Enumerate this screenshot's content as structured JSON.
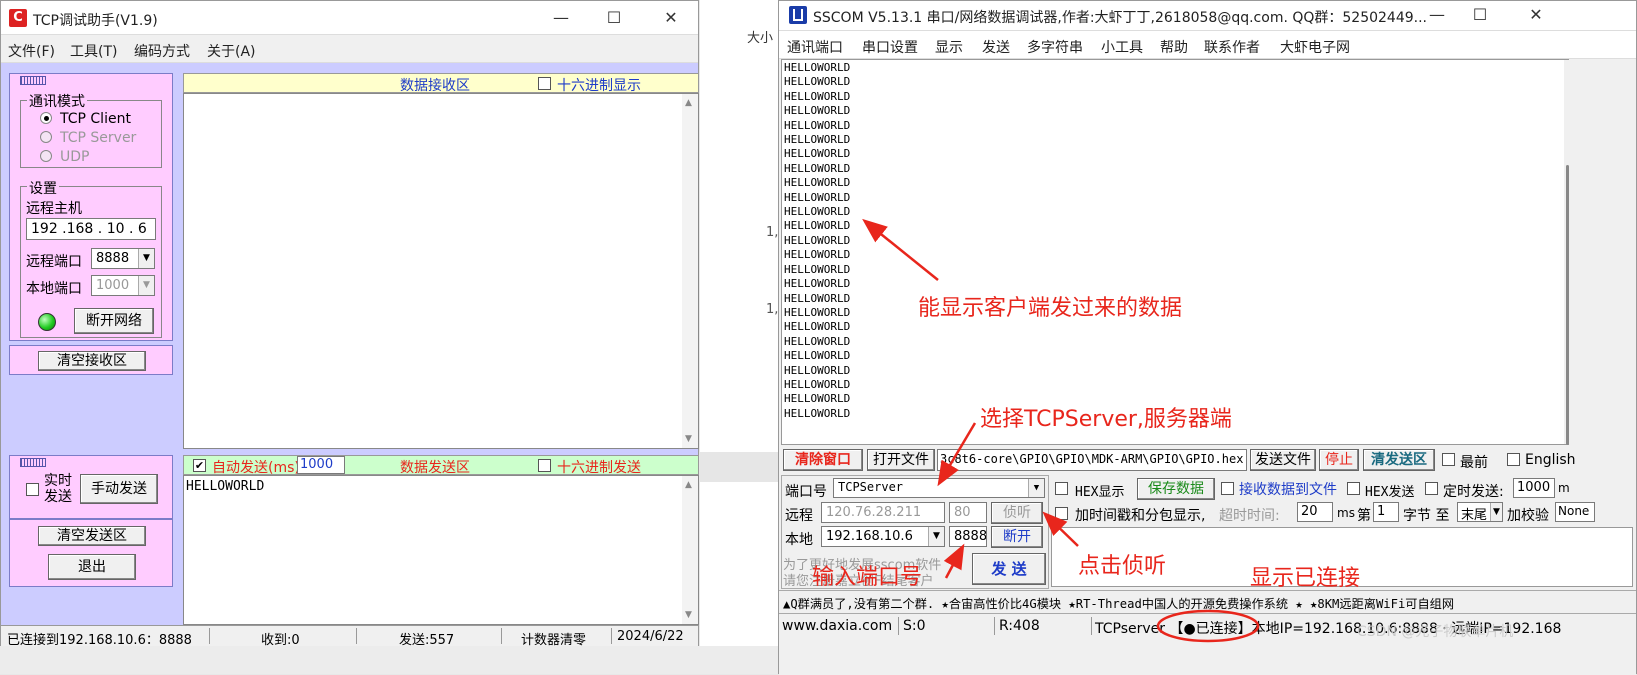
{
  "tcp": {
    "title": "TCP调试助手(V1.9)",
    "menus": [
      "文件(F)",
      "工具(T)",
      "编码方式",
      "关于(A)"
    ],
    "comm_mode_label": "通讯模式",
    "modes": [
      "TCP Client",
      "TCP Server",
      "UDP"
    ],
    "settings_label": "设置",
    "remote_host_label": "远程主机",
    "remote_host": "192 .168 . 10 . 6",
    "remote_port_label": "远程端口",
    "remote_port": "8888",
    "local_port_label": "本地端口",
    "local_port": "1000",
    "disconnect_btn": "断开网络",
    "clear_recv_btn": "清空接收区",
    "recv_title": "数据接收区",
    "hex_display": "十六进制显示",
    "realtime_send": "实时发送",
    "manual_send_btn": "手动发送",
    "clear_send_btn": "清空发送区",
    "exit_btn": "退出",
    "auto_send_label": "自动发送(ms)",
    "auto_send_interval": "1000",
    "send_title": "数据发送区",
    "hex_send": "十六进制发送",
    "send_text": "HELLOWORLD",
    "status": {
      "connected": "已连接到192.168.10.6：8888",
      "received": "收到:0",
      "sent": "发送:557",
      "reset": "计数器清零",
      "date": "2024/6/22"
    },
    "led_color": "#22cc22"
  },
  "bg": {
    "text1": "大小",
    "text2": "1,",
    "text3": "1,"
  },
  "sscom": {
    "title": "SSCOM V5.13.1 串口/网络数据调试器,作者:大虾丁丁,2618058@qq.com. QQ群：52502449...",
    "menus": [
      "通讯端口",
      "串口设置",
      "显示",
      "发送",
      "多字符串",
      "小工具",
      "帮助",
      "联系作者",
      "大虾电子网"
    ],
    "received_line": "HELLOWORLD",
    "received_count": 25,
    "btn_clear": "清除窗口",
    "btn_open": "打开文件",
    "file_path": "3c8t6-core\\GPIO\\GPIO\\MDK-ARM\\GPIO\\GPIO.hex",
    "btn_sendfile": "发送文件",
    "btn_stop": "停止",
    "btn_clear_send": "清发送区",
    "opt_top": "最前",
    "opt_english": "English",
    "port_label": "端口号",
    "port_value": "TCPServer",
    "hex_display": "HEX显示",
    "save_data": "保存数据",
    "recv_to_file": "接收数据到文件",
    "hex_send": "HEX发送",
    "timed_send": "定时发送:",
    "timed_value": "1000",
    "timed_unit": "m",
    "remote_label": "远程",
    "remote_ip": "120.76.28.211",
    "remote_port": "80",
    "listen_btn": "侦听",
    "timestamp_label": "加时间戳和分包显示,",
    "timeout_label": "超时时间:",
    "timeout_value": "20",
    "timeout_unit": "ms",
    "nth_label": "第",
    "nth_value": "1",
    "byte_label": "字节 至",
    "end_value": "末尾",
    "checksum_label": "加校验",
    "checksum_value": "None",
    "local_label": "本地",
    "local_ip": "192.168.10.6",
    "local_port": "8888",
    "disconnect_btn": "断开",
    "promo1": "为了更好地发展sscom软件",
    "promo2": "请您注册嘉立创F结尾客户",
    "send_btn": "发 送",
    "ticker": "▲Q群满员了,没有第二个群. ★合宙高性价比4G模块 ★RT-Thread中国人的开源免费操作系统 ★ ★8KM远距离WiFi可自组网",
    "status": {
      "url": "www.daxia.com",
      "s": "S:0",
      "r": "R:408",
      "conn": "TCPserver 【●已连接】本地IP=192.168.10.6:8888 · 远端IP=192.168"
    },
    "watermark": "CSDN @光子物联单片机"
  },
  "annotations": {
    "a1": "能显示客户端发过来的数据",
    "a2": "选择TCPServer,服务器端",
    "a3": "点击侦听",
    "a4": "输入端口号",
    "a5": "显示已连接"
  },
  "accent_red": "#e8261c",
  "pink_panel": "#ffccff",
  "lavender_bg": "#ccccff"
}
